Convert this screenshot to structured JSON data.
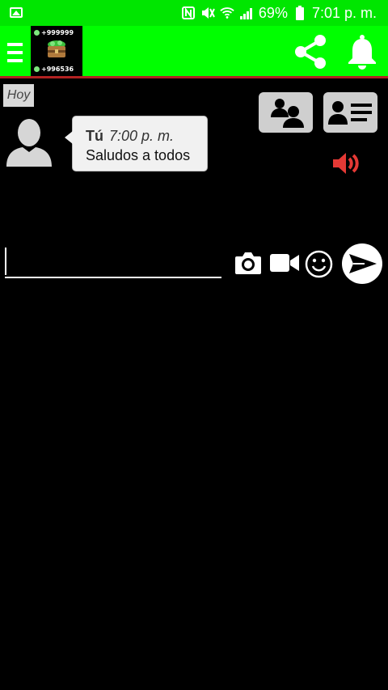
{
  "status_bar": {
    "battery": "69%",
    "time": "7:01 p. m.",
    "icons": [
      "gallery-icon",
      "nfc-icon",
      "mute-icon",
      "wifi-icon",
      "signal-icon",
      "battery-icon"
    ]
  },
  "header": {
    "menu_icon": "menu-icon",
    "logo": {
      "top_count": "+999999",
      "bottom_count": "+996536"
    },
    "share_icon": "share-icon",
    "notification_icon": "bell-icon",
    "background": "#00ff00",
    "border_color": "#b22222"
  },
  "chat": {
    "date_label": "Hoy",
    "messages": [
      {
        "sender": "Tú",
        "time": "7:00 p. m.",
        "text": "Saludos a todos",
        "avatar": "default-user-icon"
      }
    ]
  },
  "actions": {
    "contacts_icon": "users-group-icon",
    "profile_icon": "profile-card-icon",
    "speaker_icon": "speaker-icon",
    "speaker_color": "#e53935"
  },
  "composer": {
    "input_value": "",
    "camera_icon": "camera-icon",
    "video_icon": "video-camera-icon",
    "emoji_icon": "emoji-icon",
    "send_icon": "send-icon"
  }
}
